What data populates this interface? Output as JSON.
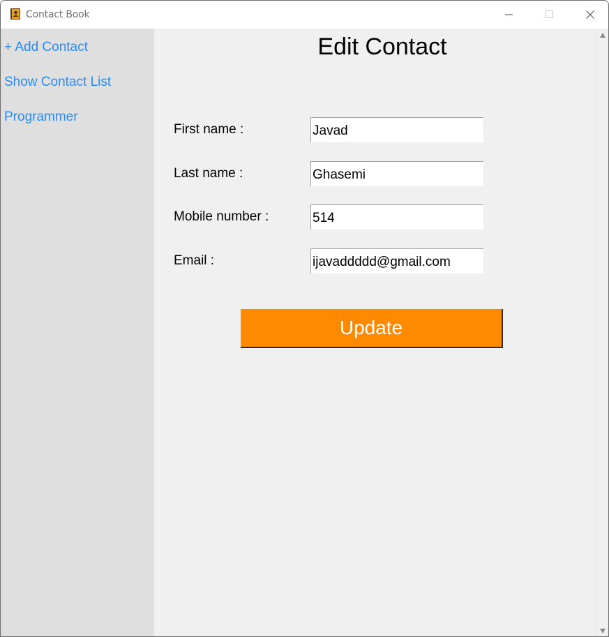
{
  "window": {
    "title": "Contact Book",
    "icon": "contact-book-icon"
  },
  "sidebar": {
    "items": [
      {
        "label": "+ Add Contact"
      },
      {
        "label": "Show Contact List"
      },
      {
        "label": "Programmer"
      }
    ],
    "link_color": "#2a8cf2"
  },
  "form": {
    "heading": "Edit Contact",
    "fields": [
      {
        "label": "First name :",
        "value": "Javad"
      },
      {
        "label": "Last name :",
        "value": "Ghasemi"
      },
      {
        "label": "Mobile number :",
        "value": "514"
      },
      {
        "label": "Email :",
        "value": "ijavaddddd@gmail.com"
      }
    ],
    "update_label": "Update",
    "button_color": "#ff8a00"
  }
}
